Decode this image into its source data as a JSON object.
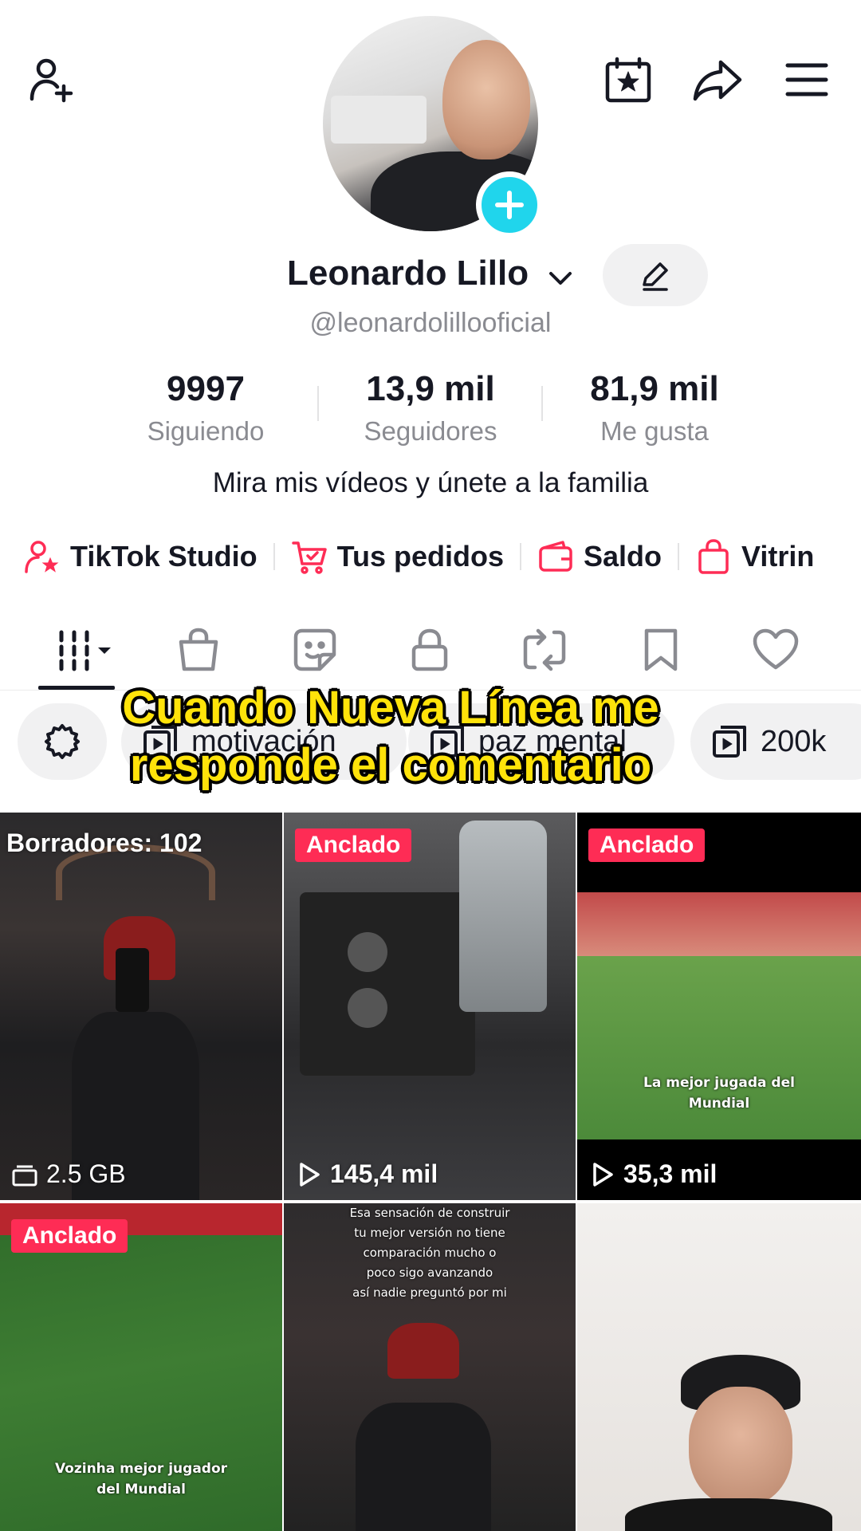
{
  "profile": {
    "name": "Leonardo Lillo",
    "handle": "@leonardolillooficial",
    "bio": "Mira mis vídeos y únete a la familia"
  },
  "stats": [
    {
      "value": "9997",
      "label": "Siguiendo"
    },
    {
      "value": "13,9 mil",
      "label": "Seguidores"
    },
    {
      "value": "81,9 mil",
      "label": "Me gusta"
    }
  ],
  "quick_links": [
    {
      "label": "TikTok Studio",
      "icon": "person-star-icon"
    },
    {
      "label": "Tus pedidos",
      "icon": "cart-icon"
    },
    {
      "label": "Saldo",
      "icon": "wallet-icon"
    },
    {
      "label": "Vitrin",
      "icon": "shopping-bag-icon"
    }
  ],
  "tabs": [
    "grid-icon",
    "shop-bag-icon",
    "sticker-icon",
    "lock-icon",
    "repost-icon",
    "bookmark-icon",
    "heart-icon"
  ],
  "playlists": [
    {
      "label": "motivación"
    },
    {
      "label": "paz mental"
    },
    {
      "label": "200k"
    }
  ],
  "caption": {
    "line1": "Cuando Nueva Línea me",
    "line2": "responde el comentario"
  },
  "videos": [
    {
      "badge": "Borradores: 102",
      "meta": "2.5 GB"
    },
    {
      "badge": "Anclado",
      "meta": "145,4 mil"
    },
    {
      "badge": "Anclado",
      "meta": "35,3 mil",
      "overlay": [
        "La mejor jugada del",
        "Mundial"
      ]
    },
    {
      "badge": "Anclado",
      "overlay": [
        "Vozinha mejor jugador",
        "del Mundial"
      ]
    },
    {
      "overlay": [
        "Esa sensación de construir",
        "tu mejor versión no tiene",
        "comparación mucho o",
        "poco sigo avanzando",
        "así nadie preguntó por mi"
      ]
    },
    {}
  ],
  "colors": {
    "accent_pink": "#fe2c55",
    "cyan": "#20d5ec",
    "caption_yellow": "#ffe30a"
  }
}
